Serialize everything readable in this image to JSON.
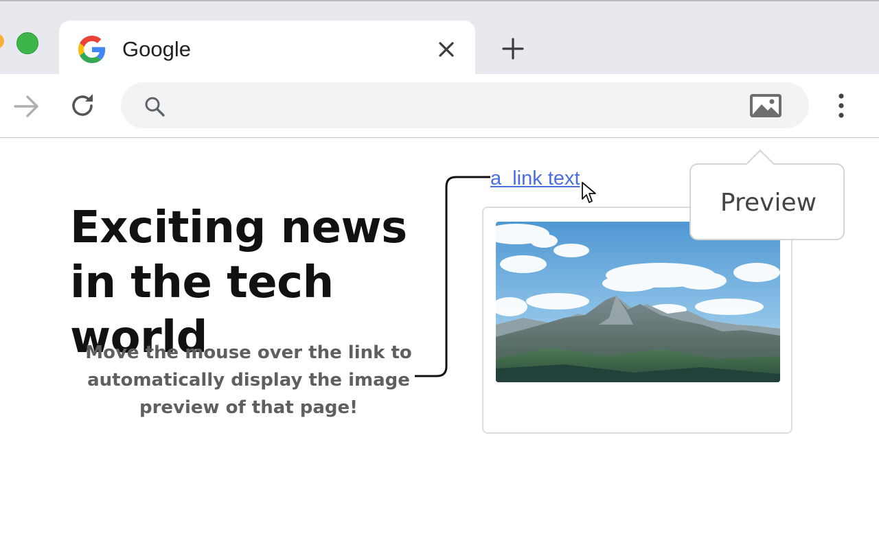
{
  "browser": {
    "tab": {
      "title": "Google",
      "favicon": "google-g-icon",
      "close_icon": "close-icon"
    },
    "new_tab_icon": "plus-icon",
    "toolbar": {
      "forward_icon": "arrow-right-icon",
      "reload_icon": "reload-icon",
      "search_icon": "search-icon",
      "address_value": "",
      "extension_icon": "image-icon",
      "menu_icon": "more-vertical-icon"
    },
    "colors": {
      "tabstrip": "#e8e9ee",
      "omnibox": "#f1f3f4",
      "link": "#4a6ee0"
    }
  },
  "page": {
    "headline": "Exciting news in the tech world",
    "description": "Move the mouse over the link to automatically display the image preview of that page!",
    "link_text": "a  link text",
    "preview_image": "mountain-landscape-image",
    "callout": "Preview"
  }
}
